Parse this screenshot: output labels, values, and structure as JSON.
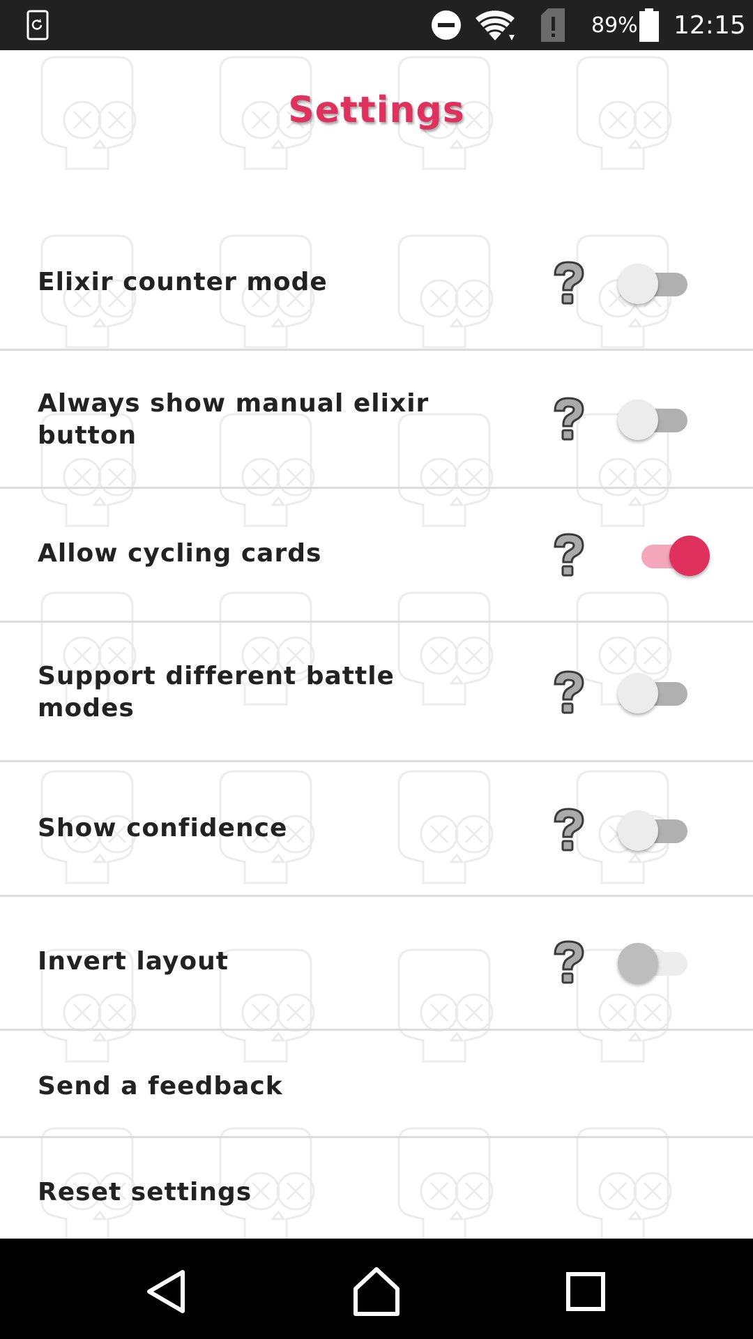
{
  "status_bar": {
    "battery_percent": "89%",
    "time": "12:15",
    "icons": [
      "screen-rotate-icon",
      "do-not-disturb-icon",
      "wifi-icon",
      "sim-alert-icon",
      "battery-icon"
    ]
  },
  "header": {
    "title": "Settings"
  },
  "settings": [
    {
      "label": "Elixir counter mode",
      "toggle": "off",
      "help_icon": "question-mark-icon"
    },
    {
      "label": "Always show manual elixir button",
      "toggle": "off",
      "help_icon": "question-mark-icon"
    },
    {
      "label": "Allow cycling cards",
      "toggle": "on",
      "help_icon": "question-mark-icon"
    },
    {
      "label": "Support different battle modes",
      "toggle": "off",
      "help_icon": "question-mark-icon"
    },
    {
      "label": "Show confidence",
      "toggle": "off",
      "help_icon": "question-mark-icon"
    },
    {
      "label": "Invert layout",
      "toggle": "off",
      "help_icon": "question-mark-icon"
    }
  ],
  "actions": [
    {
      "label": "Send a feedback"
    },
    {
      "label": "Reset settings"
    }
  ],
  "nav_bar": {
    "icons": [
      "back-icon",
      "home-icon",
      "recents-icon"
    ]
  },
  "colors": {
    "accent": "#e0305e",
    "accent_track": "#f4a7ba",
    "status_bar_bg": "#212121",
    "nav_bar_bg": "#000000",
    "text": "#222222",
    "divider": "#dcdcdc"
  }
}
